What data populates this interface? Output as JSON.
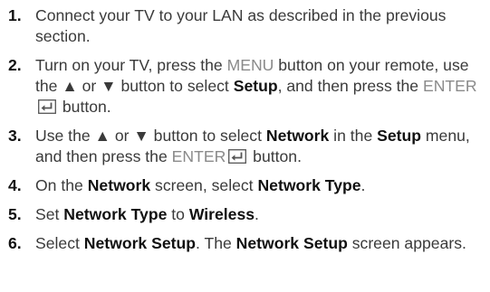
{
  "steps": [
    {
      "number": "1.",
      "parts": [
        "Connect your TV to your LAN as described in the previous section."
      ]
    },
    {
      "number": "2.",
      "parts": [
        "Turn on your TV, press the ",
        "MENU",
        " button on your remote, use the ▲ or ▼ button to select ",
        "Setup",
        ", and then press the ",
        "ENTER",
        " button."
      ]
    },
    {
      "number": "3.",
      "parts": [
        "Use the ▲ or ▼ button to select ",
        "Network",
        " in the ",
        "Setup",
        " menu, and then press the ",
        "ENTER",
        " button."
      ]
    },
    {
      "number": "4.",
      "parts": [
        "On the ",
        "Network",
        " screen, select ",
        "Network Type",
        "."
      ]
    },
    {
      "number": "5.",
      "parts": [
        "Set ",
        "Network Type",
        " to ",
        "Wireless",
        "."
      ]
    },
    {
      "number": "6.",
      "parts": [
        "Select ",
        "Network Setup",
        ". The ",
        "Network Setup",
        " screen appears."
      ]
    }
  ],
  "icons": {
    "enter": "enter-icon"
  }
}
